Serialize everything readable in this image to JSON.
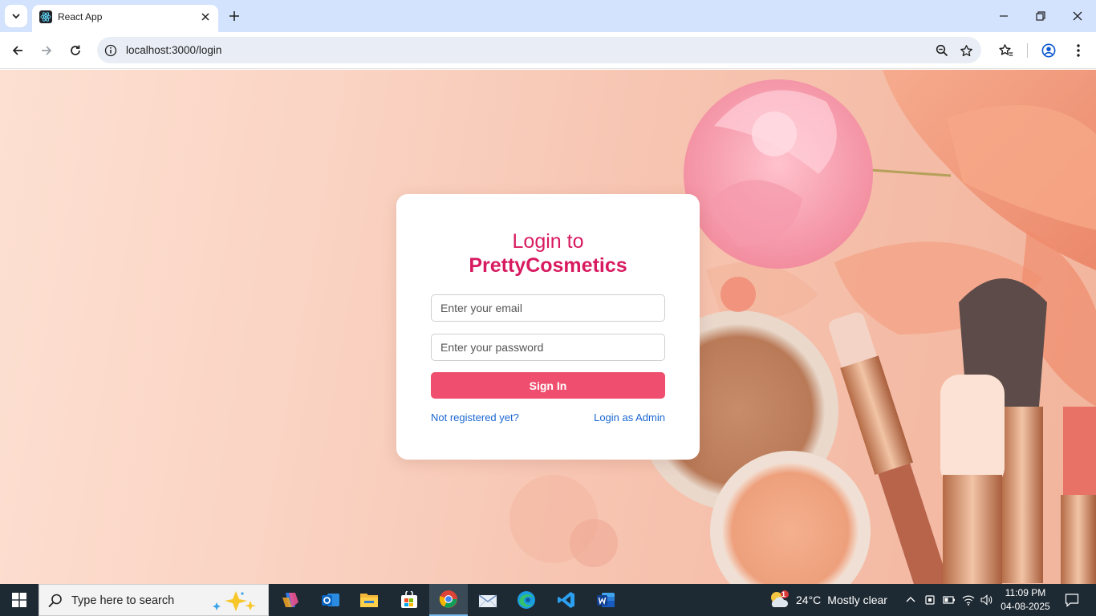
{
  "browser": {
    "tab_title": "React App",
    "url": "localhost:3000/login"
  },
  "login": {
    "title_line1": "Login to",
    "title_line2": "PrettyCosmetics",
    "email_placeholder": "Enter your email",
    "password_placeholder": "Enter your password",
    "signin_label": "Sign In",
    "register_link": "Not registered yet?",
    "admin_link": "Login as Admin",
    "accent_color": "#d81b60",
    "button_color": "#f04e6e",
    "link_color": "#1a66d1"
  },
  "taskbar": {
    "search_placeholder": "Type here to search",
    "weather_temp": "24°C",
    "weather_desc": "Mostly clear",
    "weather_badge": "1",
    "time": "11:09 PM",
    "date": "04-08-2025",
    "apps": [
      "copilot-icon",
      "outlook-icon",
      "file-explorer-icon",
      "microsoft-store-icon",
      "chrome-icon",
      "mail-icon",
      "edge-icon",
      "vscode-icon",
      "word-icon"
    ]
  }
}
